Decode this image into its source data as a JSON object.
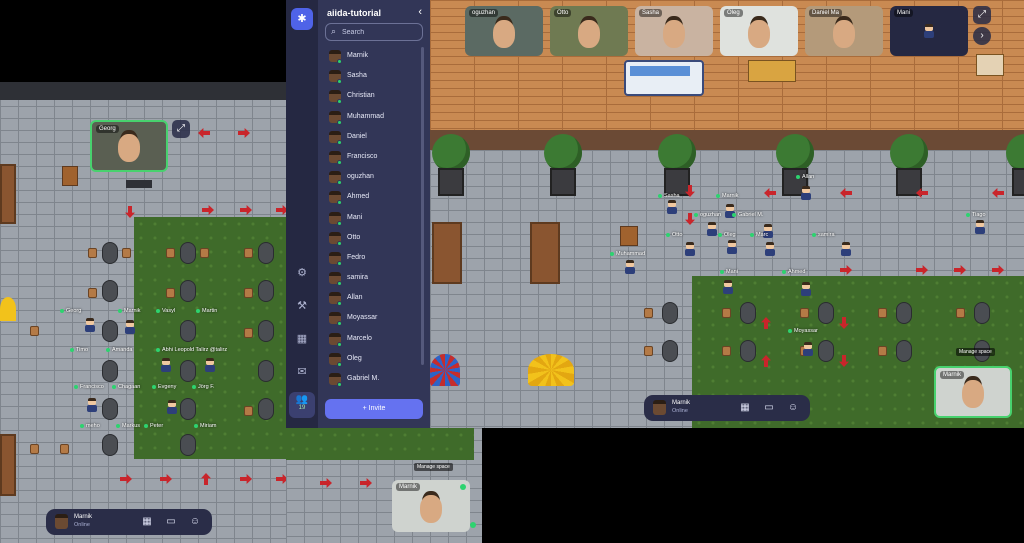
{
  "sidebar": {
    "space_name": "aiida-tutorial",
    "collapse_icon": "chevron-left-icon",
    "search": {
      "placeholder": "Search",
      "value": ""
    },
    "participants": [
      "Marnik",
      "Sasha",
      "Christian",
      "Muhammad",
      "Daniel",
      "Francisco",
      "oguzhan",
      "Ahmed",
      "Mani",
      "Otto",
      "Fedro",
      "samira",
      "Allan",
      "Moyassar",
      "Marcelo",
      "Oleg",
      "Gabriel M."
    ],
    "invite_label": "Invite",
    "people_count": "19",
    "rail_icons": [
      "settings-icon",
      "build-hammer-icon",
      "calendar-icon",
      "chat-icon",
      "people-icon"
    ]
  },
  "top_video_tiles": [
    {
      "name": "oguzhan",
      "badge": "mic-muted"
    },
    {
      "name": "Otto",
      "badge": "none"
    },
    {
      "name": "Sasha",
      "badge": "none"
    },
    {
      "name": "Oleg",
      "badge": "none"
    },
    {
      "name": "Daniel Ma",
      "badge": "none"
    },
    {
      "name": "Mani",
      "badge": "mic-muted"
    }
  ],
  "left_video": {
    "name": "Georg"
  },
  "left_self_video": {
    "name": "Marnik",
    "popup": "Manage space"
  },
  "right_self_video": {
    "name": "Marnik",
    "popup": "Manage space"
  },
  "left_bar": {
    "user": "Marnik",
    "status": "Online"
  },
  "right_bar": {
    "user": "Marnik",
    "status": "Online"
  },
  "bar_icons": [
    "map-icon",
    "screen-share-icon",
    "emoji-icon"
  ],
  "left_map_labels": [
    "Georg",
    "Marnik",
    "Vasyl",
    "Martin",
    "Timo",
    "Amanda",
    "Abhi Leopold Talirz @talirz",
    "Francisco",
    "Chagaan",
    "Evgeny",
    "Jörg F.",
    "meho",
    "Markus",
    "Peter",
    "Miriam"
  ],
  "right_map_labels": [
    "Sasha",
    "Marnik",
    "Allan",
    "oguzhan",
    "Gabriel M.",
    "Otto",
    "Oleg",
    "Marc",
    "samira",
    "Muhammad",
    "Fedro",
    "Mani",
    "Ahmed",
    "Moyassar",
    "Neeraj",
    "Tiago"
  ]
}
